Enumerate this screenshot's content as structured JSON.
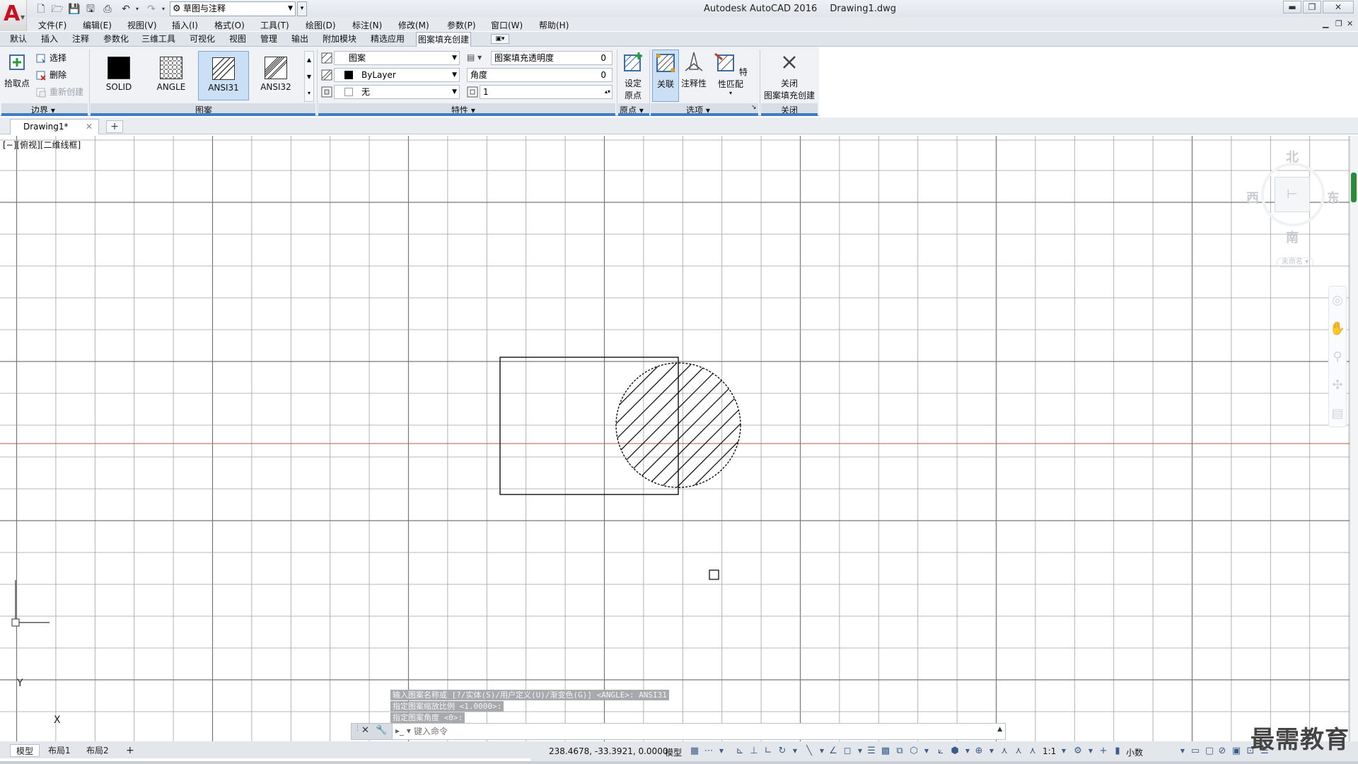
{
  "window": {
    "app_title": "Autodesk AutoCAD 2016",
    "doc_title": "Drawing1.dwg",
    "workspace": "草图与注释"
  },
  "menus": [
    "文件(F)",
    "编辑(E)",
    "视图(V)",
    "插入(I)",
    "格式(O)",
    "工具(T)",
    "绘图(D)",
    "标注(N)",
    "修改(M)",
    "参数(P)",
    "窗口(W)",
    "帮助(H)"
  ],
  "ribbon_tabs": [
    "默认",
    "插入",
    "注释",
    "参数化",
    "三维工具",
    "可视化",
    "视图",
    "管理",
    "输出",
    "附加模块",
    "精选应用",
    "图案填充创建"
  ],
  "ribbon": {
    "boundary": {
      "title": "边界",
      "pick_points": "拾取点",
      "select": "选择",
      "remove": "删除",
      "recreate": "重新创建"
    },
    "pattern": {
      "title": "图案",
      "items": [
        "SOLID",
        "ANGLE",
        "ANSI31",
        "ANSI32"
      ],
      "selected": "ANSI31"
    },
    "properties": {
      "title": "特性",
      "type": "图案",
      "color": "ByLayer",
      "background": "无",
      "transparency_label": "图案填充透明度",
      "transparency_value": "0",
      "angle_label": "角度",
      "angle_value": "0",
      "scale_value": "1"
    },
    "origin": {
      "title": "原点",
      "set_origin_line1": "设定",
      "set_origin_line2": "原点"
    },
    "options": {
      "title": "选项",
      "associative": "关联",
      "annotative": "注释性",
      "match_props": "特性匹配"
    },
    "close": {
      "title": "关闭",
      "line1": "关闭",
      "line2": "图案填充创建"
    }
  },
  "file_tab": "Drawing1*",
  "viewport_label": "[−][俯视][二维线框]",
  "viewcube": {
    "north": "北",
    "south": "南",
    "east": "东",
    "west": "西",
    "wcs": "未命名"
  },
  "ucs": {
    "x": "X",
    "y": "Y"
  },
  "command_history": [
    "输入图案名称或 [?/实体(S)/用户定义(U)/渐变色(G)] <ANGLE>: ANSI31",
    "指定图案缩放比例 <1.0000>:",
    "指定图案角度 <0>:"
  ],
  "command_placeholder": "键入命令",
  "layout_tabs": [
    "模型",
    "布局1",
    "布局2"
  ],
  "status": {
    "coords": "238.4678, -33.3921, 0.0000",
    "model": "模型",
    "scale": "1:1",
    "units": "小数"
  },
  "watermark": "最需教育",
  "colors": {
    "accent": "#3e7cc6",
    "logo_red": "#c8101e",
    "x_axis_line": "#b65a4c",
    "grid": "#808080"
  }
}
